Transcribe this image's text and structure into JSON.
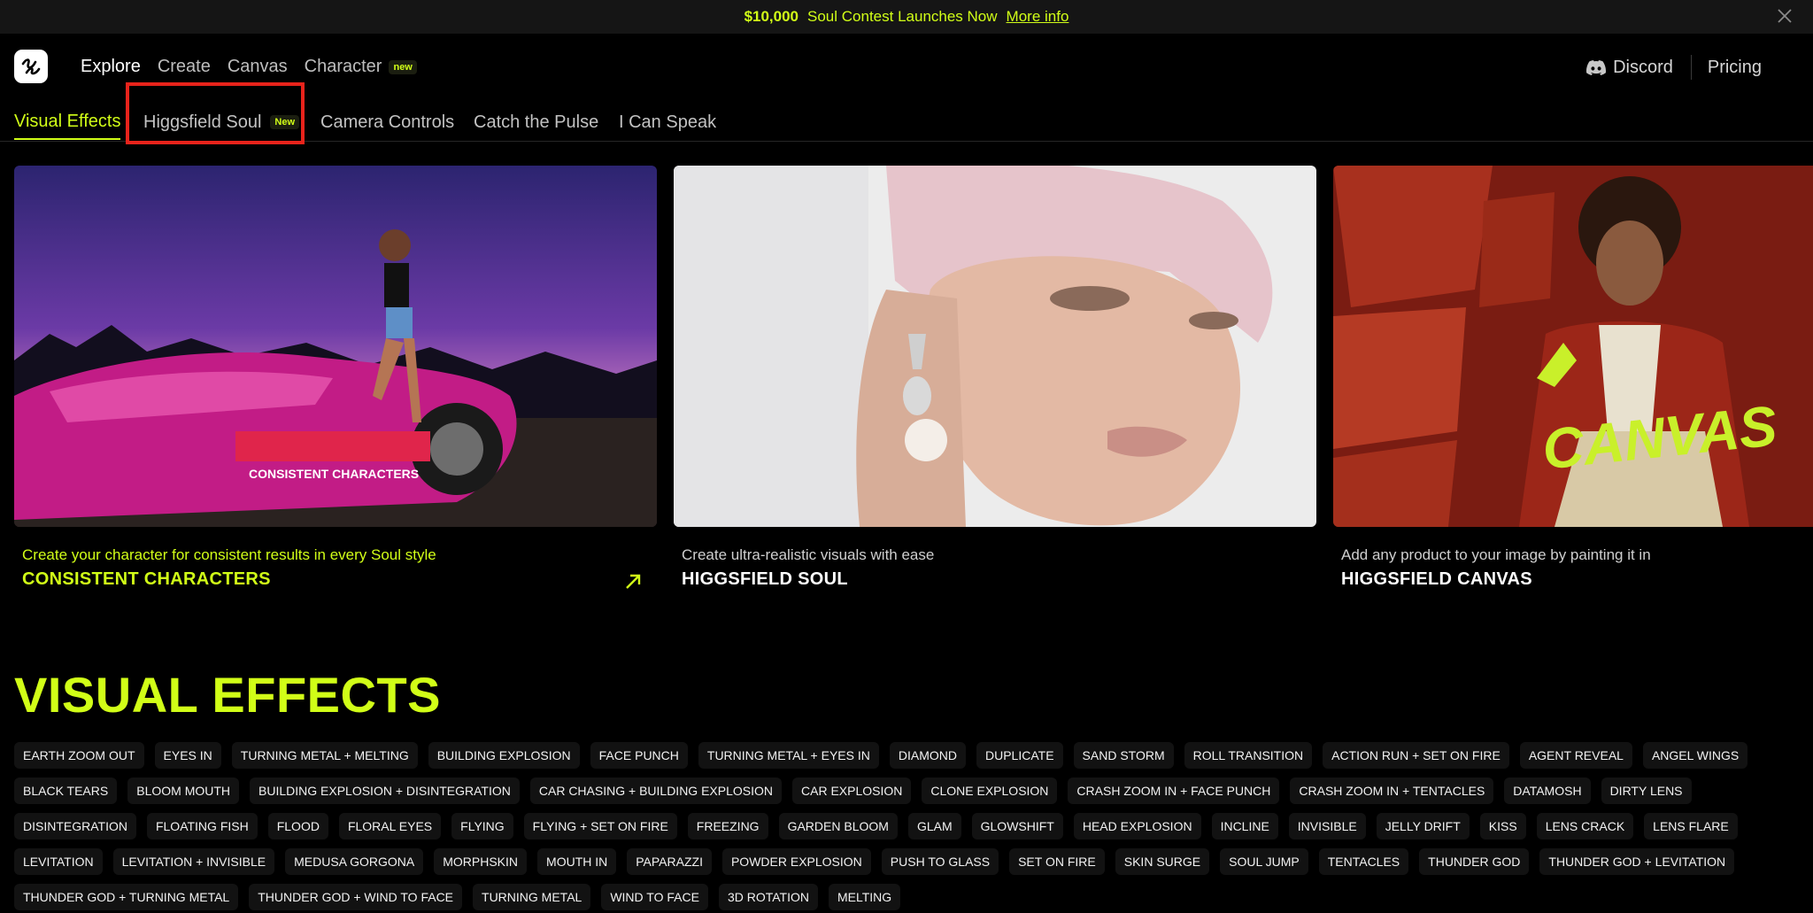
{
  "banner": {
    "amount": "$10,000",
    "message": "Soul Contest Launches Now",
    "link": "More info"
  },
  "nav": {
    "items": [
      {
        "label": "Explore"
      },
      {
        "label": "Create"
      },
      {
        "label": "Canvas"
      },
      {
        "label": "Character",
        "badge": "new"
      }
    ],
    "discord": "Discord",
    "pricing": "Pricing"
  },
  "tabs": [
    {
      "label": "Visual Effects"
    },
    {
      "label": "Higgsfield Soul",
      "badge": "New"
    },
    {
      "label": "Camera Controls"
    },
    {
      "label": "Catch the Pulse"
    },
    {
      "label": "I Can Speak"
    }
  ],
  "cards": [
    {
      "subtitle": "Create your character for consistent results in every Soul style",
      "title": "CONSISTENT CHARACTERS",
      "overlay_text": "CONSISTENT CHARACTERS"
    },
    {
      "subtitle": "Create ultra-realistic visuals with ease",
      "title": "HIGGSFIELD SOUL"
    },
    {
      "subtitle": "Add any product to your image by painting it in",
      "title": "HIGGSFIELD CANVAS",
      "overlay_text": "CANVAS"
    }
  ],
  "section": {
    "title": "VISUAL EFFECTS",
    "chips": [
      "EARTH ZOOM OUT",
      "EYES IN",
      "TURNING METAL + MELTING",
      "BUILDING EXPLOSION",
      "FACE PUNCH",
      "TURNING METAL + EYES IN",
      "DIAMOND",
      "DUPLICATE",
      "SAND STORM",
      "ROLL TRANSITION",
      "ACTION RUN + SET ON FIRE",
      "AGENT REVEAL",
      "ANGEL WINGS",
      "BLACK TEARS",
      "BLOOM MOUTH",
      "BUILDING EXPLOSION + DISINTEGRATION",
      "CAR CHASING + BUILDING EXPLOSION",
      "CAR EXPLOSION",
      "CLONE EXPLOSION",
      "CRASH ZOOM IN + FACE PUNCH",
      "CRASH ZOOM IN + TENTACLES",
      "DATAMOSH",
      "DIRTY LENS",
      "DISINTEGRATION",
      "FLOATING FISH",
      "FLOOD",
      "FLORAL EYES",
      "FLYING",
      "FLYING + SET ON FIRE",
      "FREEZING",
      "GARDEN BLOOM",
      "GLAM",
      "GLOWSHIFT",
      "HEAD EXPLOSION",
      "INCLINE",
      "INVISIBLE",
      "JELLY DRIFT",
      "KISS",
      "LENS CRACK",
      "LENS FLARE",
      "LEVITATION",
      "LEVITATION + INVISIBLE",
      "MEDUSA GORGONA",
      "MORPHSKIN",
      "MOUTH IN",
      "PAPARAZZI",
      "POWDER EXPLOSION",
      "PUSH TO GLASS",
      "SET ON FIRE",
      "SKIN SURGE",
      "SOUL JUMP",
      "TENTACLES",
      "THUNDER GOD",
      "THUNDER GOD + LEVITATION",
      "THUNDER GOD + TURNING METAL",
      "THUNDER GOD + WIND TO FACE",
      "TURNING METAL",
      "WIND TO FACE",
      "3D ROTATION",
      "MELTING"
    ]
  },
  "colors": {
    "accent": "#d1fe17",
    "highlight": "#e8231b"
  }
}
